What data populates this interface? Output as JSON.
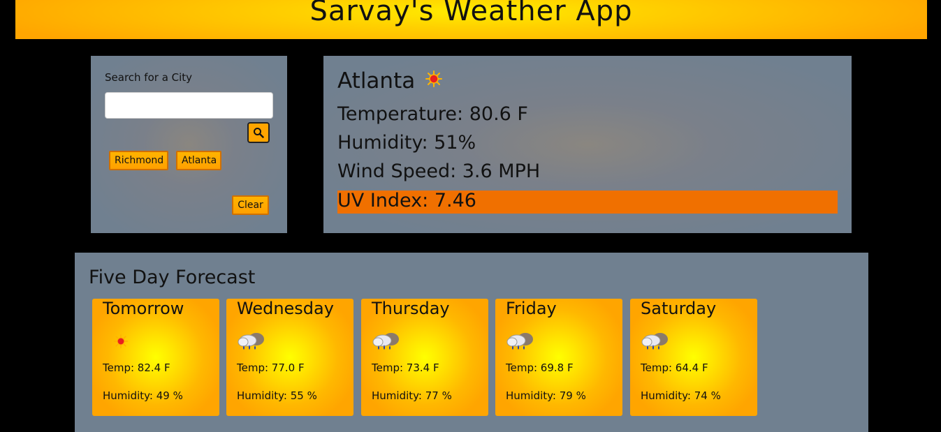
{
  "header": {
    "title": "Sarvay's Weather App"
  },
  "search": {
    "label": "Search for a City",
    "placeholder": "",
    "value": "",
    "history": [
      "Richmond",
      "Atlanta"
    ],
    "clear_label": "Clear"
  },
  "current": {
    "city": "Atlanta",
    "icon": "sun-icon",
    "temperature": "Temperature: 80.6 F",
    "humidity": "Humidity: 51%",
    "wind": "Wind Speed: 3.6 MPH",
    "uv": "UV Index: 7.46",
    "uv_color": "#f07000"
  },
  "forecast": {
    "title": "Five Day Forecast",
    "days": [
      {
        "day": "Tomorrow",
        "icon": "sun-icon",
        "temp": "Temp: 82.4 F",
        "humidity": "Humidity: 49 %"
      },
      {
        "day": "Wednesday",
        "icon": "rain-cloud-icon",
        "temp": "Temp: 77.0 F",
        "humidity": "Humidity: 55 %"
      },
      {
        "day": "Thursday",
        "icon": "rain-cloud-icon",
        "temp": "Temp: 73.4 F",
        "humidity": "Humidity: 77 %"
      },
      {
        "day": "Friday",
        "icon": "rain-cloud-icon",
        "temp": "Temp: 69.8 F",
        "humidity": "Humidity: 79 %"
      },
      {
        "day": "Saturday",
        "icon": "rain-cloud-icon",
        "temp": "Temp: 64.4 F",
        "humidity": "Humidity: 74 %"
      }
    ]
  },
  "colors": {
    "accent": "#ffa500",
    "panel": "#708090",
    "background": "#000000"
  }
}
